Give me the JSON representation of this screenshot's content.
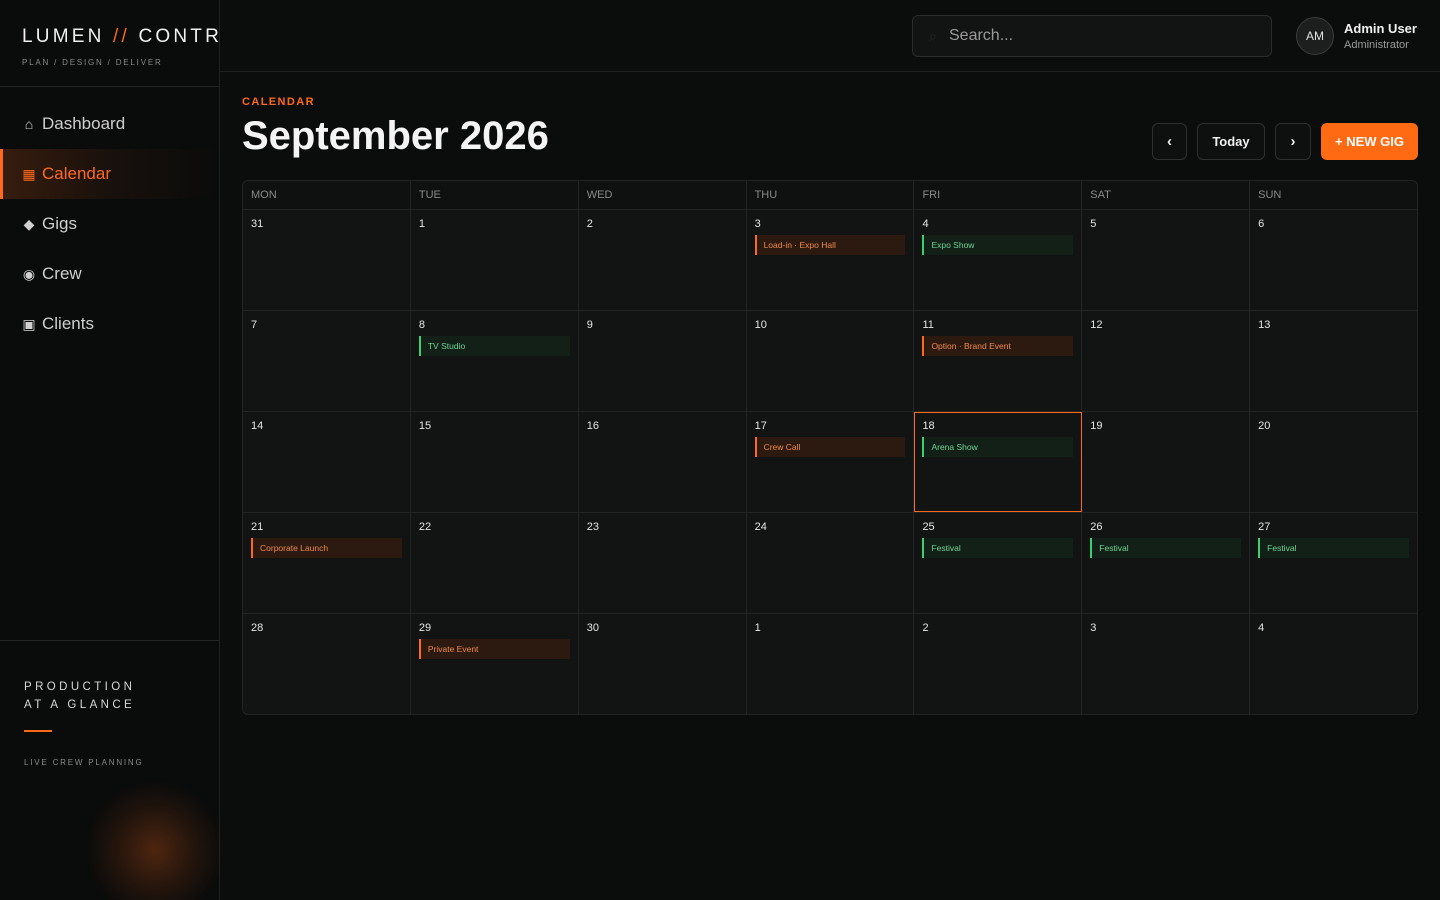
{
  "brand": {
    "name_left": "LUMEN",
    "name_sep": "//",
    "name_right": "CONTROL",
    "tagline": "PLAN / DESIGN / DELIVER"
  },
  "nav": [
    {
      "icon": "home-icon",
      "glyph": "⌂",
      "label": "Dashboard",
      "active": false
    },
    {
      "icon": "calendar-icon",
      "glyph": "▦",
      "label": "Calendar",
      "active": true
    },
    {
      "icon": "diamond-icon",
      "glyph": "◆",
      "label": "Gigs",
      "active": false
    },
    {
      "icon": "crew-icon",
      "glyph": "◉",
      "label": "Crew",
      "active": false
    },
    {
      "icon": "clients-icon",
      "glyph": "▣",
      "label": "Clients",
      "active": false
    }
  ],
  "promo": {
    "title_line1": "PRODUCTION",
    "title_line2": "AT A GLANCE",
    "subtitle": "LIVE CREW PLANNING"
  },
  "search": {
    "placeholder": "Search..."
  },
  "user": {
    "initials": "AM",
    "name": "Admin User",
    "role": "Administrator"
  },
  "page": {
    "eyebrow": "CALENDAR",
    "title": "September 2026"
  },
  "toolbar": {
    "prev": "‹",
    "today": "Today",
    "next": "›",
    "new_gig": "+ NEW GIG"
  },
  "colors": {
    "accent": "#ff6a1a",
    "confirmed": "#3ccf6e"
  },
  "calendar": {
    "weekdays": [
      "MON",
      "TUE",
      "WED",
      "THU",
      "FRI",
      "SAT",
      "SUN"
    ],
    "weeks": [
      [
        {
          "day": "31",
          "events": []
        },
        {
          "day": "1",
          "events": []
        },
        {
          "day": "2",
          "events": []
        },
        {
          "day": "3",
          "events": [
            {
              "label": "Load-in · Expo Hall",
              "kind": "orange"
            }
          ]
        },
        {
          "day": "4",
          "events": [
            {
              "label": "Expo Show",
              "kind": "green"
            }
          ]
        },
        {
          "day": "5",
          "events": []
        },
        {
          "day": "6",
          "events": []
        }
      ],
      [
        {
          "day": "7",
          "events": []
        },
        {
          "day": "8",
          "events": [
            {
              "label": "TV Studio",
              "kind": "green"
            }
          ]
        },
        {
          "day": "9",
          "events": []
        },
        {
          "day": "10",
          "events": []
        },
        {
          "day": "11",
          "events": [
            {
              "label": "Option · Brand Event",
              "kind": "orange"
            }
          ]
        },
        {
          "day": "12",
          "events": []
        },
        {
          "day": "13",
          "events": []
        }
      ],
      [
        {
          "day": "14",
          "events": []
        },
        {
          "day": "15",
          "events": []
        },
        {
          "day": "16",
          "events": []
        },
        {
          "day": "17",
          "events": [
            {
              "label": "Crew Call",
              "kind": "orange"
            }
          ]
        },
        {
          "day": "18",
          "today": true,
          "events": [
            {
              "label": "Arena Show",
              "kind": "green"
            }
          ]
        },
        {
          "day": "19",
          "events": []
        },
        {
          "day": "20",
          "events": []
        }
      ],
      [
        {
          "day": "21",
          "events": [
            {
              "label": "Corporate Launch",
              "kind": "orange"
            }
          ]
        },
        {
          "day": "22",
          "events": []
        },
        {
          "day": "23",
          "events": []
        },
        {
          "day": "24",
          "events": []
        },
        {
          "day": "25",
          "events": [
            {
              "label": "Festival",
              "kind": "green"
            }
          ]
        },
        {
          "day": "26",
          "events": [
            {
              "label": "Festival",
              "kind": "green"
            }
          ]
        },
        {
          "day": "27",
          "events": [
            {
              "label": "Festival",
              "kind": "green"
            }
          ]
        }
      ],
      [
        {
          "day": "28",
          "events": []
        },
        {
          "day": "29",
          "events": [
            {
              "label": "Private Event",
              "kind": "orange"
            }
          ]
        },
        {
          "day": "30",
          "events": []
        },
        {
          "day": "1",
          "events": []
        },
        {
          "day": "2",
          "events": []
        },
        {
          "day": "3",
          "events": []
        },
        {
          "day": "4",
          "events": []
        }
      ]
    ]
  }
}
